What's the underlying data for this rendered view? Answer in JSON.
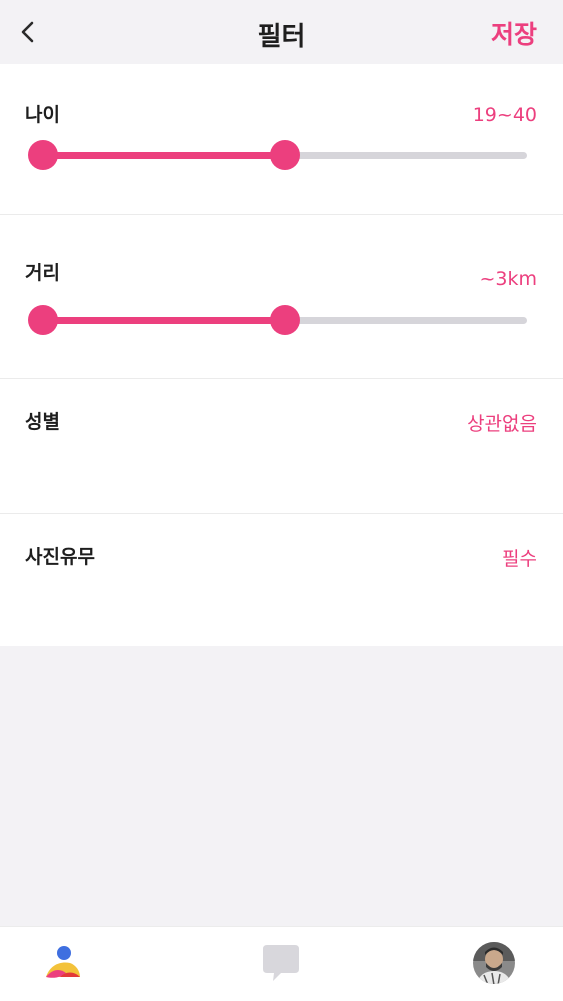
{
  "header": {
    "title": "필터",
    "save_label": "저장"
  },
  "filters": {
    "age": {
      "label": "나이",
      "value": "19~40",
      "range_fraction": [
        0,
        0.5
      ]
    },
    "distance": {
      "label": "거리",
      "value": "~3km",
      "range_fraction": [
        0,
        0.5
      ]
    },
    "gender": {
      "label": "성별",
      "value": "상관없음"
    },
    "photo": {
      "label": "사진유무",
      "value": "필수"
    }
  },
  "colors": {
    "accent": "#ec3f7e",
    "track": "#d6d5da",
    "background": "#f3f2f5"
  },
  "tabs": [
    {
      "icon": "people-icon"
    },
    {
      "icon": "chat-bubble-icon"
    },
    {
      "icon": "profile-avatar"
    }
  ]
}
